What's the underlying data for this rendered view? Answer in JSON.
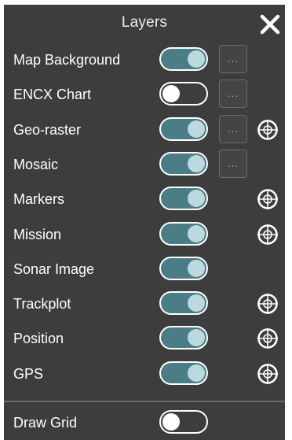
{
  "panel": {
    "title": "Layers",
    "close_icon": "close-icon"
  },
  "layers": [
    {
      "label": "Map Background",
      "on": true,
      "has_options": true,
      "has_target": false
    },
    {
      "label": "ENCX Chart",
      "on": false,
      "has_options": true,
      "has_target": false
    },
    {
      "label": "Geo-raster",
      "on": true,
      "has_options": true,
      "has_target": true
    },
    {
      "label": "Mosaic",
      "on": true,
      "has_options": true,
      "has_target": false
    },
    {
      "label": "Markers",
      "on": true,
      "has_options": false,
      "has_target": true
    },
    {
      "label": "Mission",
      "on": true,
      "has_options": false,
      "has_target": true
    },
    {
      "label": "Sonar Image",
      "on": true,
      "has_options": false,
      "has_target": false
    },
    {
      "label": "Trackplot",
      "on": true,
      "has_options": false,
      "has_target": true
    },
    {
      "label": "Position",
      "on": true,
      "has_options": false,
      "has_target": true
    },
    {
      "label": "GPS",
      "on": true,
      "has_options": false,
      "has_target": true
    }
  ],
  "draw_grid": {
    "label": "Draw Grid",
    "on": false
  },
  "options_button_label": "...",
  "icons": {
    "options": "more-options-icon",
    "target": "crosshair-target-icon"
  },
  "colors": {
    "panel_bg": "#3d3d3d",
    "toggle_on_track": "#4b7d86",
    "toggle_on_knob": "#bcd9df",
    "toggle_off_knob": "#ffffff",
    "text": "#ffffff"
  }
}
